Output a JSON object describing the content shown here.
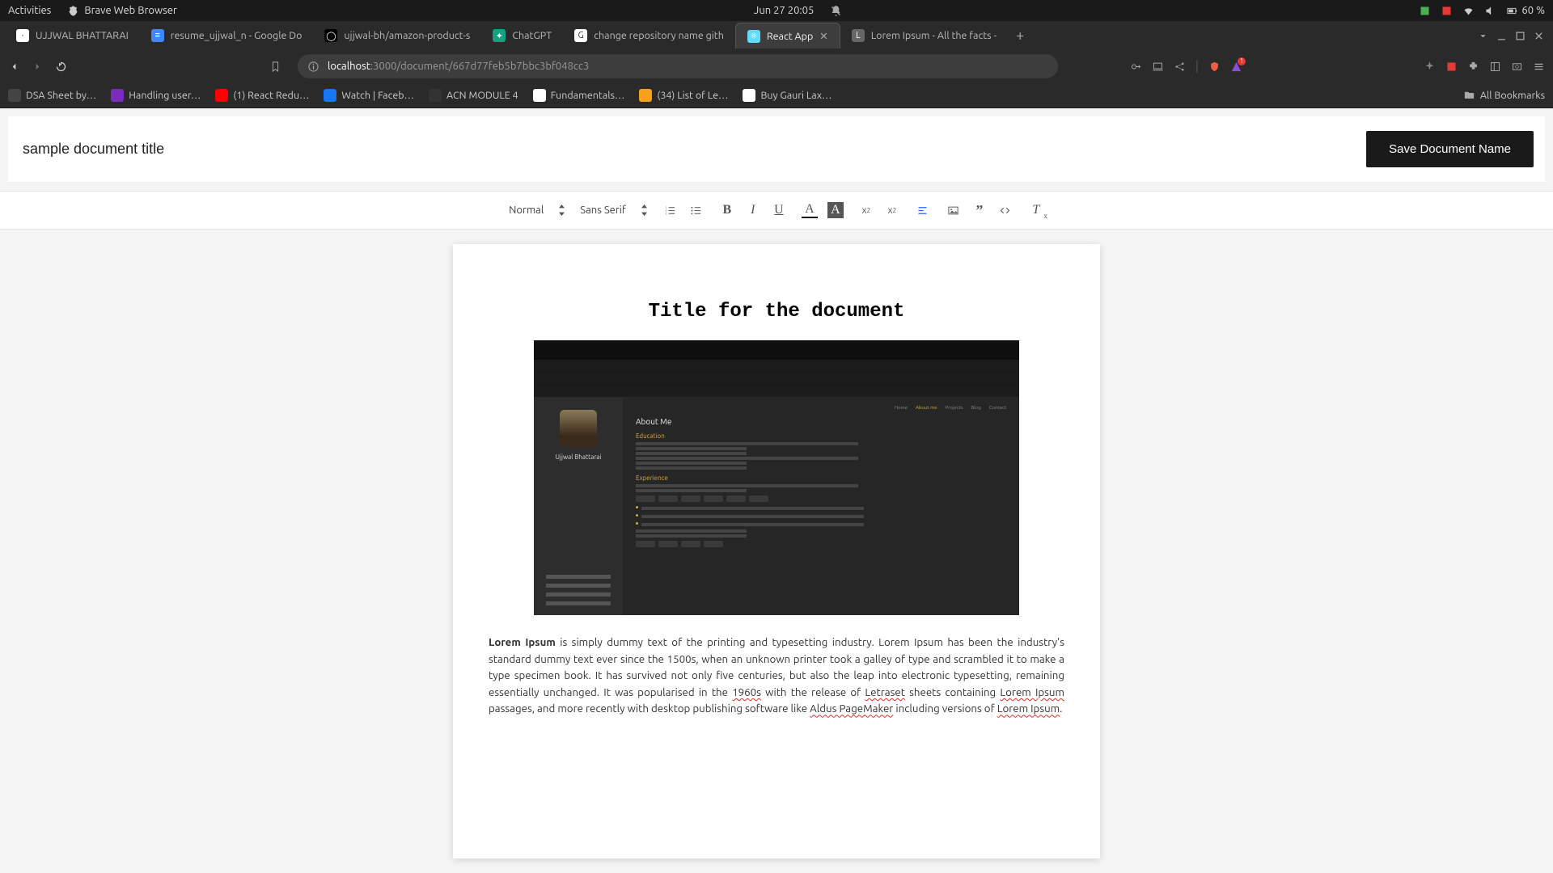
{
  "os": {
    "activities": "Activities",
    "app_name": "Brave Web Browser",
    "datetime": "Jun 27  20:05",
    "battery": "60 %"
  },
  "tabs": [
    {
      "label": "UJJWAL BHATTARAI",
      "icon_bg": "#fff",
      "icon_txt": "·"
    },
    {
      "label": "resume_ujjwal_n - Google Do",
      "icon_bg": "#4285f4",
      "icon_txt": "≡"
    },
    {
      "label": "ujjwal-bh/amazon-product-s",
      "icon_bg": "#000",
      "icon_txt": "◯"
    },
    {
      "label": "ChatGPT",
      "icon_bg": "#10a37f",
      "icon_txt": "✦"
    },
    {
      "label": "change repository name gith",
      "icon_bg": "#fff",
      "icon_txt": "G"
    },
    {
      "label": "React App",
      "icon_bg": "#61dafb",
      "icon_txt": "⚛",
      "active": true
    },
    {
      "label": "Lorem Ipsum - All the facts -",
      "icon_bg": "#666",
      "icon_txt": "L"
    }
  ],
  "url": {
    "host": "localhost",
    "port_path": ":3000/document/667d77feb5b7bbc3bf048cc3"
  },
  "bookmarks": [
    {
      "label": "DSA Sheet by…",
      "bg": "#444"
    },
    {
      "label": "Handling user…",
      "bg": "#7b2cbf"
    },
    {
      "label": "(1) React Redu…",
      "bg": "#ff0000"
    },
    {
      "label": "Watch | Faceb…",
      "bg": "#1877f2"
    },
    {
      "label": "ACN MODULE 4",
      "bg": "#333"
    },
    {
      "label": "Fundamentals…",
      "bg": "#fff"
    },
    {
      "label": "(34) List of Le…",
      "bg": "#f89f1b"
    },
    {
      "label": "Buy Gauri Lax…",
      "bg": "#fff"
    }
  ],
  "all_bookmarks": "All Bookmarks",
  "doc": {
    "title_input": "sample document title",
    "save_btn": "Save Document Name",
    "toolbar": {
      "format": "Normal",
      "font": "Sans Serif"
    },
    "heading": "Title for the document",
    "mini": {
      "name": "Ujjwal Bhattarai",
      "about": "About Me",
      "edu": "Education",
      "exp": "Experience",
      "nav": [
        "Home",
        "About me",
        "Projects",
        "Blog",
        "Contact"
      ]
    },
    "para_bold": "Lorem Ipsum",
    "para_1": " is simply dummy text of the printing and typesetting industry. Lorem Ipsum has been the industry's standard dummy text ever since the 1500s, when an unknown printer took a galley of type and scrambled it to make a type specimen book. It has survived not only five centuries, but also the leap into electronic typesetting, remaining essentially unchanged. It was popularised in the ",
    "para_sp1": "1960s",
    "para_2": " with the release of ",
    "para_sp2": "Letraset",
    "para_3": " sheets containing ",
    "para_sp3": "Lorem Ipsum",
    "para_4": " passages, and more recently with desktop publishing software like ",
    "para_sp4": "Aldus PageMaker",
    "para_5": " including versions of ",
    "para_sp5": "Lorem Ipsum",
    "para_6": "."
  }
}
